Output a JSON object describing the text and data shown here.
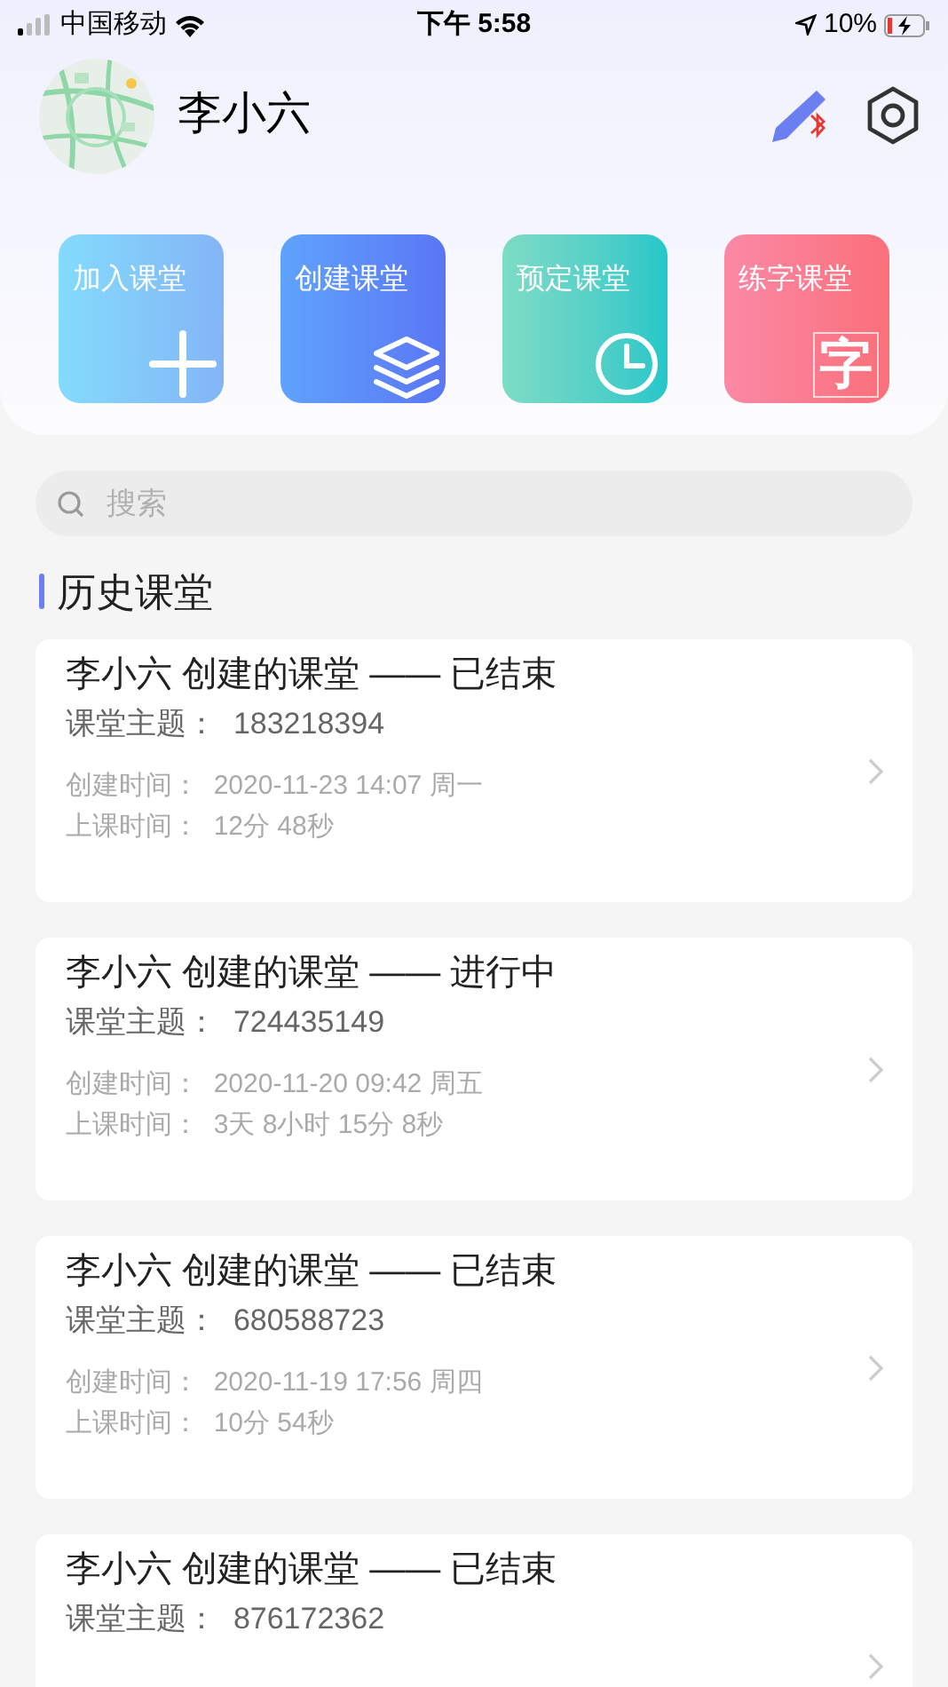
{
  "status_bar": {
    "carrier": "中国移动",
    "time": "下午 5:58",
    "battery": "10%"
  },
  "profile": {
    "name": "李小六"
  },
  "actions": [
    {
      "label": "加入课堂",
      "kind": "join"
    },
    {
      "label": "创建课堂",
      "kind": "create"
    },
    {
      "label": "预定课堂",
      "kind": "schedule"
    },
    {
      "label": "练字课堂",
      "kind": "practice",
      "glyph": "字"
    }
  ],
  "search": {
    "placeholder": "搜索"
  },
  "section_title": "历史课堂",
  "classes": [
    {
      "title": "李小六 创建的课堂 —— 已结束",
      "topic": "课堂主题：  183218394",
      "created": "创建时间：  2020-11-23 14:07 周一",
      "duration": "上课时间：  12分 48秒"
    },
    {
      "title": "李小六 创建的课堂 —— 进行中",
      "topic": "课堂主题：  724435149",
      "created": "创建时间：  2020-11-20 09:42 周五",
      "duration": "上课时间：  3天 8小时 15分 8秒"
    },
    {
      "title": "李小六 创建的课堂 —— 已结束",
      "topic": "课堂主题：  680588723",
      "created": "创建时间：  2020-11-19 17:56 周四",
      "duration": "上课时间：  10分 54秒"
    },
    {
      "title": "李小六 创建的课堂 —— 已结束",
      "topic": "课堂主题：  876172362"
    }
  ]
}
